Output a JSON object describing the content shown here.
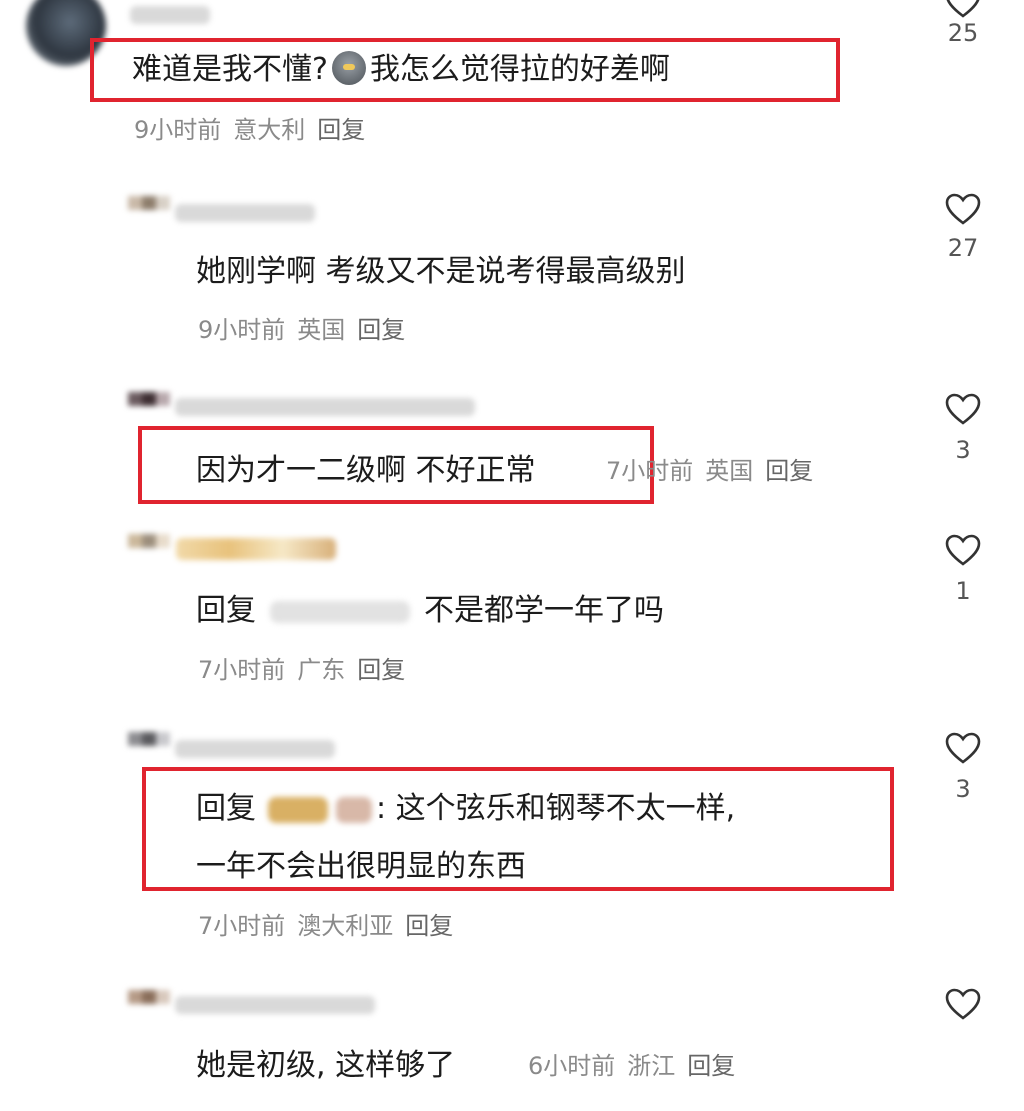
{
  "comments": [
    {
      "text_part1": "难道是我不懂?",
      "text_part2": "我怎么觉得拉的好差啊",
      "emoji": "crying-face-icon",
      "time": "9小时前",
      "location": "意大利",
      "reply": "回复",
      "likes": "25"
    },
    {
      "text": "她刚学啊 考级又不是说考得最高级别",
      "time": "9小时前",
      "location": "英国",
      "reply": "回复",
      "likes": "27"
    },
    {
      "text": "因为才一二级啊 不好正常",
      "time": "7小时前",
      "location": "英国",
      "reply": "回复",
      "likes": "3"
    },
    {
      "reply_prefix": "回复",
      "text": "不是都学一年了吗",
      "time": "7小时前",
      "location": "广东",
      "reply": "回复",
      "likes": "1"
    },
    {
      "reply_prefix": "回复",
      "text_line1": ": 这个弦乐和钢琴不太一样,",
      "text_line2": "一年不会出很明显的东西",
      "time": "7小时前",
      "location": "澳大利亚",
      "reply": "回复",
      "likes": "3"
    },
    {
      "text": "她是初级, 这样够了",
      "time": "6小时前",
      "location": "浙江",
      "reply": "回复"
    }
  ],
  "colors": {
    "highlight": "#e0242f",
    "meta": "#8a8a8a"
  }
}
